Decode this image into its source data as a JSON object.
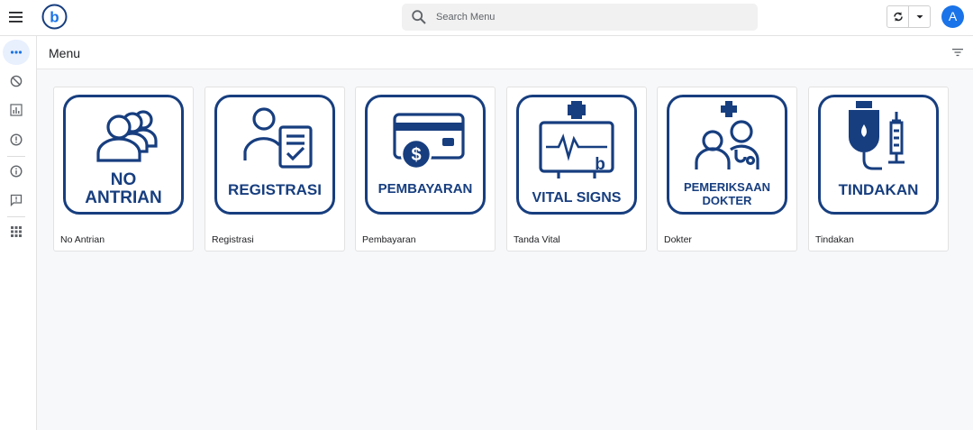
{
  "header": {
    "menu_icon": "hamburger-icon",
    "logo_letter": "b",
    "search_placeholder": "Search Menu",
    "avatar_initial": "A"
  },
  "rail": {
    "items": [
      "more-horiz-icon",
      "block-icon",
      "bar-chart-icon",
      "error-icon",
      "info-icon",
      "feedback-icon",
      "apps-icon"
    ]
  },
  "page": {
    "title": "Menu"
  },
  "cards": [
    {
      "label": "No Antrian",
      "tile_lines": [
        "NO",
        "ANTRIAN"
      ],
      "icon": "people-queue-icon"
    },
    {
      "label": "Registrasi",
      "tile_lines": [
        "REGISTRASI"
      ],
      "icon": "user-clipboard-icon"
    },
    {
      "label": "Pembayaran",
      "tile_lines": [
        "PEMBAYARAN"
      ],
      "icon": "card-payment-icon"
    },
    {
      "label": "Tanda Vital",
      "tile_lines": [
        "VITAL SIGNS"
      ],
      "icon": "heart-monitor-icon"
    },
    {
      "label": "Dokter",
      "tile_lines": [
        "PEMERIKSAAN",
        "DOKTER"
      ],
      "icon": "doctor-patient-icon"
    },
    {
      "label": "Tindakan",
      "tile_lines": [
        "TINDAKAN"
      ],
      "icon": "iv-syringe-icon"
    }
  ],
  "colors": {
    "brand_navy": "#173e7f",
    "accent_blue": "#1a73e8"
  }
}
